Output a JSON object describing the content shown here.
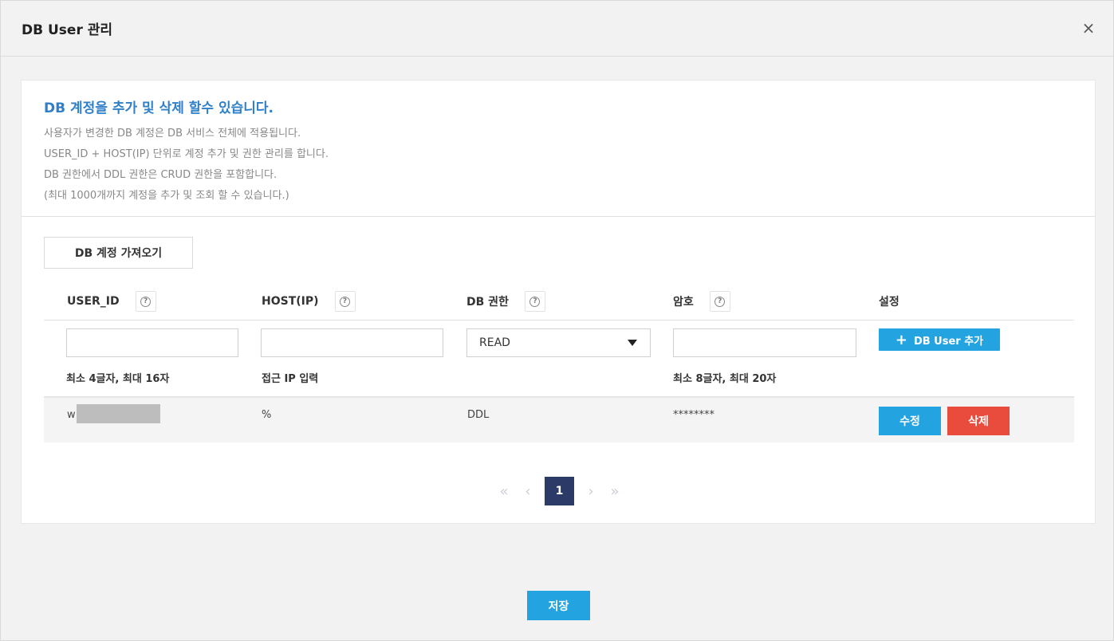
{
  "dialog": {
    "title": "DB User 관리",
    "close_icon": "×"
  },
  "info": {
    "title": "DB 계정을 추가 및 삭제 할수 있습니다.",
    "lines": [
      "사용자가 변경한 DB 계정은 DB 서비스 전체에 적용됩니다.",
      "USER_ID + HOST(IP) 단위로 계정 추가 및 권한 관리를 합니다.",
      "DB 권한에서 DDL 권한은 CRUD 권한을 포함합니다.",
      "(최대 1000개까지 계정을 추가 및 조회 할 수 있습니다.)"
    ]
  },
  "import_button": "DB 계정 가져오기",
  "table": {
    "headers": {
      "user_id": "USER_ID",
      "host": "HOST(IP)",
      "privilege": "DB 권한",
      "password": "암호",
      "settings": "설정"
    },
    "help_icon": "?",
    "new_row": {
      "user_id_value": "",
      "host_value": "",
      "privilege_selected": "READ",
      "password_value": "",
      "add_button": "DB User 추가",
      "add_icon": "+",
      "hints": {
        "user_id": "최소 4글자, 최대 16자",
        "host": "접근 IP 입력",
        "password": "최소 8글자, 최대 20자"
      }
    },
    "rows": [
      {
        "user_id": "w",
        "host": "%",
        "privilege": "DDL",
        "password": "********",
        "edit_label": "수정",
        "delete_label": "삭제"
      }
    ]
  },
  "pagination": {
    "first": "«",
    "prev": "‹",
    "current": "1",
    "next": "›",
    "last": "»"
  },
  "save_button": "저장",
  "colors": {
    "accent": "#23a3e0",
    "danger": "#e94b3c",
    "pager_active": "#2b3a67",
    "info_title": "#2f7fc9"
  }
}
